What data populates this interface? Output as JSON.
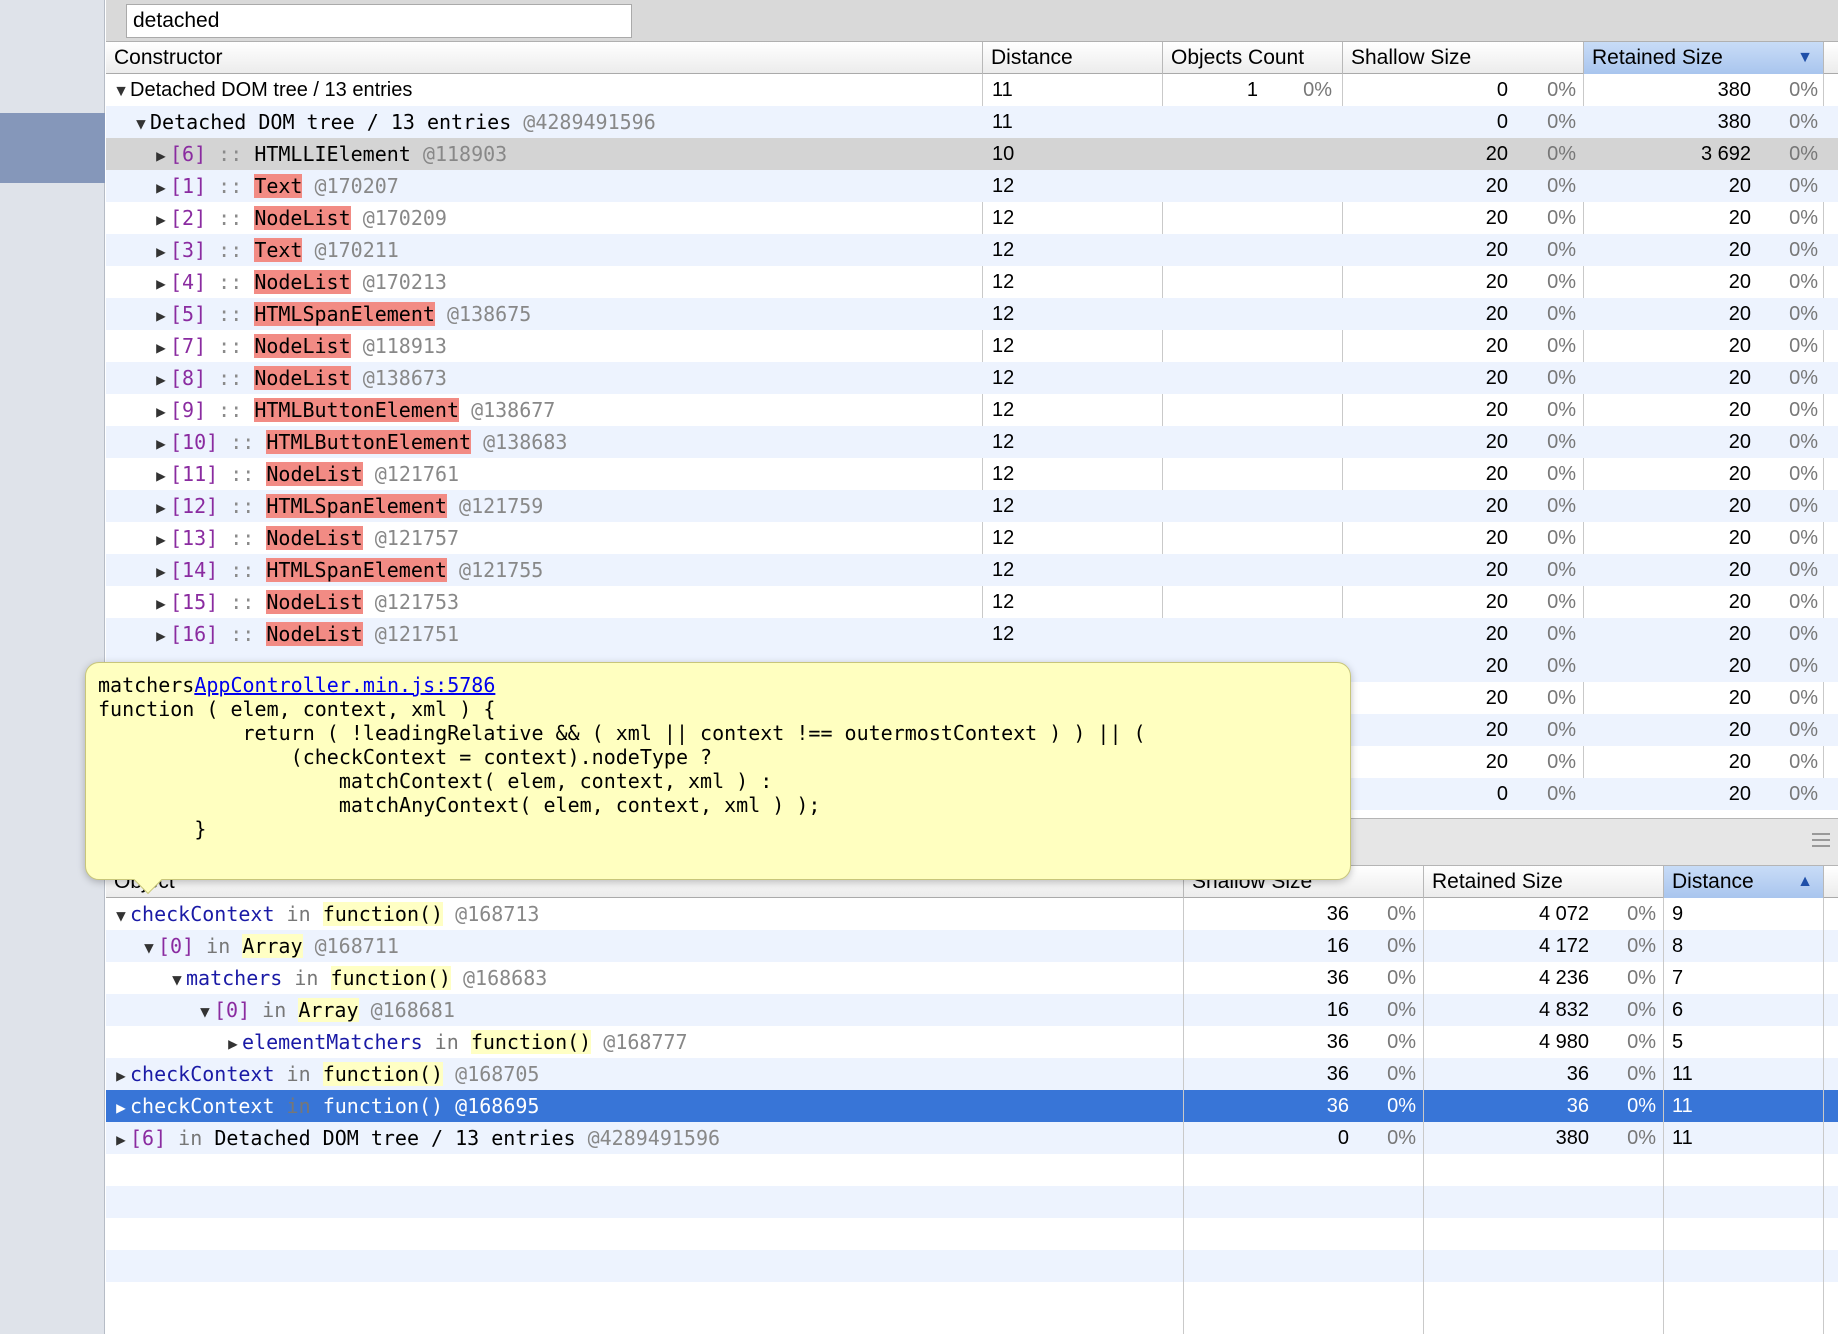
{
  "filter": {
    "value": "detached"
  },
  "constructors_grid": {
    "headers": {
      "constructor": "Constructor",
      "distance": "Distance",
      "objects_count": "Objects Count",
      "shallow_size": "Shallow Size",
      "retained_size": "Retained Size"
    },
    "sorted_column": "retained_size",
    "root": {
      "name": "Detached DOM tree / 13 entries",
      "distance": "11",
      "count": "1",
      "count_pct": "0%",
      "shallow": "0",
      "shallow_pct": "0%",
      "retained": "380",
      "retained_pct": "0%"
    },
    "child": {
      "name": "Detached DOM tree / 13 entries",
      "address": "@4289491596",
      "distance": "11",
      "shallow": "0",
      "shallow_pct": "0%",
      "retained": "380",
      "retained_pct": "0%"
    },
    "entries": [
      {
        "index": "[6]",
        "sep": "::",
        "name": "HTMLLIElement",
        "detached": false,
        "address": "@118903",
        "distance": "10",
        "shallow": "20",
        "shallow_pct": "0%",
        "retained": "3 692",
        "retained_pct": "0%"
      },
      {
        "index": "[1]",
        "sep": "::",
        "name": "Text",
        "detached": true,
        "address": "@170207",
        "distance": "12",
        "shallow": "20",
        "shallow_pct": "0%",
        "retained": "20",
        "retained_pct": "0%"
      },
      {
        "index": "[2]",
        "sep": "::",
        "name": "NodeList",
        "detached": true,
        "address": "@170209",
        "distance": "12",
        "shallow": "20",
        "shallow_pct": "0%",
        "retained": "20",
        "retained_pct": "0%"
      },
      {
        "index": "[3]",
        "sep": "::",
        "name": "Text",
        "detached": true,
        "address": "@170211",
        "distance": "12",
        "shallow": "20",
        "shallow_pct": "0%",
        "retained": "20",
        "retained_pct": "0%"
      },
      {
        "index": "[4]",
        "sep": "::",
        "name": "NodeList",
        "detached": true,
        "address": "@170213",
        "distance": "12",
        "shallow": "20",
        "shallow_pct": "0%",
        "retained": "20",
        "retained_pct": "0%"
      },
      {
        "index": "[5]",
        "sep": "::",
        "name": "HTMLSpanElement",
        "detached": true,
        "address": "@138675",
        "distance": "12",
        "shallow": "20",
        "shallow_pct": "0%",
        "retained": "20",
        "retained_pct": "0%"
      },
      {
        "index": "[7]",
        "sep": "::",
        "name": "NodeList",
        "detached": true,
        "address": "@118913",
        "distance": "12",
        "shallow": "20",
        "shallow_pct": "0%",
        "retained": "20",
        "retained_pct": "0%"
      },
      {
        "index": "[8]",
        "sep": "::",
        "name": "NodeList",
        "detached": true,
        "address": "@138673",
        "distance": "12",
        "shallow": "20",
        "shallow_pct": "0%",
        "retained": "20",
        "retained_pct": "0%"
      },
      {
        "index": "[9]",
        "sep": "::",
        "name": "HTMLButtonElement",
        "detached": true,
        "address": "@138677",
        "distance": "12",
        "shallow": "20",
        "shallow_pct": "0%",
        "retained": "20",
        "retained_pct": "0%"
      },
      {
        "index": "[10]",
        "sep": "::",
        "name": "HTMLButtonElement",
        "detached": true,
        "address": "@138683",
        "distance": "12",
        "shallow": "20",
        "shallow_pct": "0%",
        "retained": "20",
        "retained_pct": "0%"
      },
      {
        "index": "[11]",
        "sep": "::",
        "name": "NodeList",
        "detached": true,
        "address": "@121761",
        "distance": "12",
        "shallow": "20",
        "shallow_pct": "0%",
        "retained": "20",
        "retained_pct": "0%"
      },
      {
        "index": "[12]",
        "sep": "::",
        "name": "HTMLSpanElement",
        "detached": true,
        "address": "@121759",
        "distance": "12",
        "shallow": "20",
        "shallow_pct": "0%",
        "retained": "20",
        "retained_pct": "0%"
      },
      {
        "index": "[13]",
        "sep": "::",
        "name": "NodeList",
        "detached": true,
        "address": "@121757",
        "distance": "12",
        "shallow": "20",
        "shallow_pct": "0%",
        "retained": "20",
        "retained_pct": "0%"
      },
      {
        "index": "[14]",
        "sep": "::",
        "name": "HTMLSpanElement",
        "detached": true,
        "address": "@121755",
        "distance": "12",
        "shallow": "20",
        "shallow_pct": "0%",
        "retained": "20",
        "retained_pct": "0%"
      },
      {
        "index": "[15]",
        "sep": "::",
        "name": "NodeList",
        "detached": true,
        "address": "@121753",
        "distance": "12",
        "shallow": "20",
        "shallow_pct": "0%",
        "retained": "20",
        "retained_pct": "0%"
      },
      {
        "index": "[16]",
        "sep": "::",
        "name": "NodeList",
        "detached": true,
        "address": "@121751",
        "distance": "12",
        "shallow": "20",
        "shallow_pct": "0%",
        "retained": "20",
        "retained_pct": "0%"
      }
    ],
    "hidden_rows": [
      {
        "shallow": "20",
        "shallow_pct": "0%",
        "retained": "20",
        "retained_pct": "0%"
      },
      {
        "shallow": "20",
        "shallow_pct": "0%",
        "retained": "20",
        "retained_pct": "0%"
      },
      {
        "shallow": "20",
        "shallow_pct": "0%",
        "retained": "20",
        "retained_pct": "0%"
      },
      {
        "shallow": "20",
        "shallow_pct": "0%",
        "retained": "20",
        "retained_pct": "0%"
      },
      {
        "shallow": "0",
        "shallow_pct": "0%",
        "retained": "20",
        "retained_pct": "0%"
      }
    ]
  },
  "tooltip": {
    "name": "matchers",
    "link": "AppController.min.js:5786",
    "code": "function ( elem, context, xml ) {\n            return ( !leadingRelative && ( xml || context !== outermostContext ) ) || (\n                (checkContext = context).nodeType ?\n                    matchContext( elem, context, xml ) :\n                    matchAnyContext( elem, context, xml ) );\n        }"
  },
  "retainers_grid": {
    "headers": {
      "object": "Object",
      "shallow_size": "Shallow Size",
      "retained_size": "Retained Size",
      "distance": "Distance"
    },
    "sorted_column": "distance",
    "rows": [
      {
        "indent": 0,
        "expanded": true,
        "prop": "checkContext",
        "prop_kind": "prop",
        "in": "in",
        "type": "function()",
        "type_box": true,
        "address": "@168713",
        "shallow": "36",
        "shallow_pct": "0%",
        "retained": "4 072",
        "retained_pct": "0%",
        "distance": "9"
      },
      {
        "indent": 1,
        "expanded": true,
        "prop": "[0]",
        "prop_kind": "index",
        "in": "in",
        "type": "Array",
        "type_box": true,
        "address": "@168711",
        "shallow": "16",
        "shallow_pct": "0%",
        "retained": "4 172",
        "retained_pct": "0%",
        "distance": "8"
      },
      {
        "indent": 2,
        "expanded": true,
        "prop": "matchers",
        "prop_kind": "prop",
        "in": "in",
        "type": "function()",
        "type_box": true,
        "address": "@168683",
        "shallow": "36",
        "shallow_pct": "0%",
        "retained": "4 236",
        "retained_pct": "0%",
        "distance": "7"
      },
      {
        "indent": 3,
        "expanded": true,
        "prop": "[0]",
        "prop_kind": "index",
        "in": "in",
        "type": "Array",
        "type_box": true,
        "address": "@168681",
        "shallow": "16",
        "shallow_pct": "0%",
        "retained": "4 832",
        "retained_pct": "0%",
        "distance": "6"
      },
      {
        "indent": 4,
        "expanded": false,
        "prop": "elementMatchers",
        "prop_kind": "prop",
        "in": "in",
        "type": "function()",
        "type_box": true,
        "address": "@168777",
        "shallow": "36",
        "shallow_pct": "0%",
        "retained": "4 980",
        "retained_pct": "0%",
        "distance": "5"
      },
      {
        "indent": 0,
        "expanded": false,
        "prop": "checkContext",
        "prop_kind": "prop",
        "in": "in",
        "type": "function()",
        "type_box": true,
        "address": "@168705",
        "shallow": "36",
        "shallow_pct": "0%",
        "retained": "36",
        "retained_pct": "0%",
        "distance": "11"
      },
      {
        "indent": 0,
        "expanded": false,
        "selected": true,
        "prop": "checkContext",
        "prop_kind": "prop",
        "in": "in",
        "type": "function()",
        "type_box": true,
        "address": "@168695",
        "shallow": "36",
        "shallow_pct": "0%",
        "retained": "36",
        "retained_pct": "0%",
        "distance": "11"
      },
      {
        "indent": 0,
        "expanded": false,
        "prop": "[6]",
        "prop_kind": "index",
        "in": "in",
        "type": "Detached DOM tree / 13 entries",
        "type_box": false,
        "address": "@4289491596",
        "shallow": "0",
        "shallow_pct": "0%",
        "retained": "380",
        "retained_pct": "0%",
        "distance": "11"
      }
    ]
  },
  "colors": {
    "detached_highlight": "#f28b84",
    "selection": "#3875d7",
    "alt_row": "#edf3fe",
    "tooltip_bg": "#ffffc0"
  }
}
